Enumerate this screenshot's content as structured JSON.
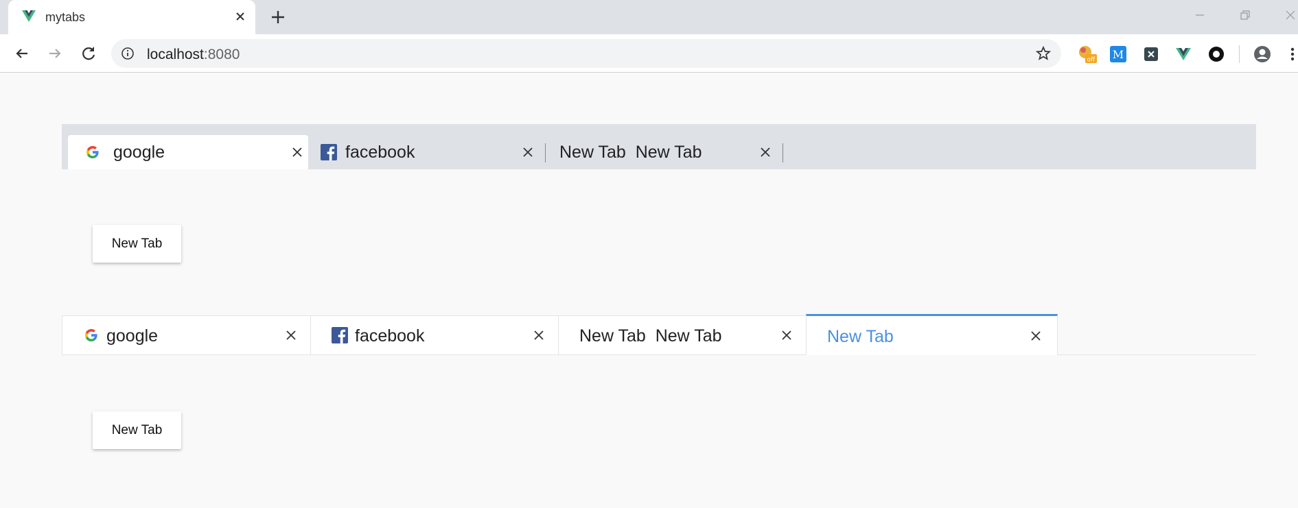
{
  "browser": {
    "tab_title": "mytabs",
    "url_host": "localhost",
    "url_port": ":8080"
  },
  "tabs_chrome_style": [
    {
      "icon": "google-icon",
      "label": "google",
      "active": true
    },
    {
      "icon": "facebook-icon",
      "label": "facebook",
      "active": false
    },
    {
      "icon": "",
      "label": "New Tab  New Tab",
      "active": false
    }
  ],
  "tabs_bordered_style": [
    {
      "icon": "google-icon",
      "label": "google",
      "active": false
    },
    {
      "icon": "facebook-icon",
      "label": "facebook",
      "active": false
    },
    {
      "icon": "",
      "label": "New Tab  New Tab",
      "active": false
    },
    {
      "icon": "",
      "label": "New Tab",
      "active": true
    }
  ],
  "buttons": {
    "new_tab_1": "New Tab",
    "new_tab_2": "New Tab"
  },
  "colors": {
    "accent": "#4a90e2",
    "tab_bar": "#dee1e6",
    "page_bg": "#f9f9f9"
  },
  "extensions": [
    "honey-off-icon",
    "m-extension-icon",
    "x-extension-icon",
    "vue-devtools-icon",
    "circle-extension-icon",
    "profile-icon",
    "menu-icon"
  ]
}
